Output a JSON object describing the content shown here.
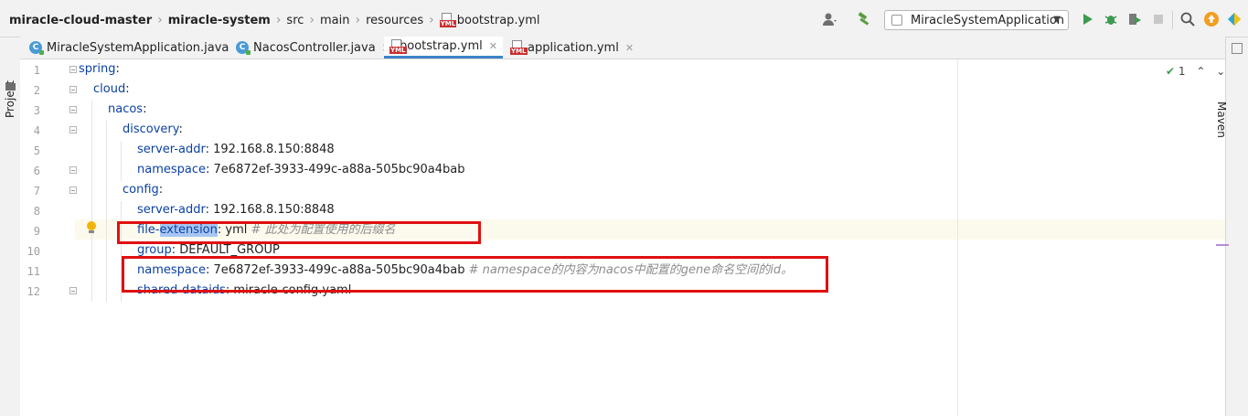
{
  "breadcrumb": {
    "items": [
      "miracle-cloud-master",
      "miracle-system",
      "src",
      "main",
      "resources",
      "bootstrap.yml"
    ]
  },
  "toolbar": {
    "run_config": "MiracleSystemApplication",
    "icons": [
      "user-icon",
      "hammer-icon",
      "run-icon",
      "debug-icon",
      "coverage-icon",
      "stop-icon",
      "search-icon",
      "update-icon",
      "plugin-icon"
    ]
  },
  "tabs": [
    {
      "label": "MiracleSystemApplication.java",
      "icon": "java-class-icon",
      "active": false
    },
    {
      "label": "NacosController.java",
      "icon": "java-class-icon",
      "active": false
    },
    {
      "label": "bootstrap.yml",
      "icon": "yml-icon",
      "active": true
    },
    {
      "label": "application.yml",
      "icon": "yml-icon",
      "active": false
    }
  ],
  "side": {
    "left_label": "Project",
    "right_label": "Maven"
  },
  "inspections": {
    "count": "1"
  },
  "editor": {
    "line_numbers": [
      "1",
      "2",
      "3",
      "4",
      "5",
      "6",
      "7",
      "8",
      "9",
      "10",
      "11",
      "12"
    ],
    "lines": [
      {
        "key": "spring",
        "sep": ":",
        "value": "",
        "comment": ""
      },
      {
        "key": "cloud",
        "sep": ":",
        "value": "",
        "comment": ""
      },
      {
        "key": "nacos",
        "sep": ":",
        "value": "",
        "comment": ""
      },
      {
        "key": "discovery",
        "sep": ":",
        "value": "",
        "comment": ""
      },
      {
        "key": "server-addr",
        "sep": ":",
        "value": " 192.168.8.150:8848",
        "comment": ""
      },
      {
        "key": "namespace",
        "sep": ":",
        "value": " 7e6872ef-3933-499c-a88a-505bc90a4bab",
        "comment": ""
      },
      {
        "key": "config",
        "sep": ":",
        "value": "",
        "comment": ""
      },
      {
        "key": "server-addr",
        "sep": ":",
        "value": " 192.168.8.150:8848",
        "comment": ""
      },
      {
        "key_a": "file-",
        "key_b": "extension",
        "sep": ":",
        "value": " yml",
        "comment": " # 此处为配置使用的后缀名"
      },
      {
        "key": "group",
        "sep": ":",
        "value": " DEFAULT_GROUP",
        "comment": ""
      },
      {
        "key": "namespace",
        "sep": ":",
        "value": " 7e6872ef-3933-499c-a88a-505bc90a4bab",
        "comment": " # namespace的内容为nacos中配置的gene命名空间的id。"
      },
      {
        "key": "shared-dataids",
        "sep": ":",
        "value": " miracle-config.yaml",
        "comment": ""
      }
    ]
  }
}
